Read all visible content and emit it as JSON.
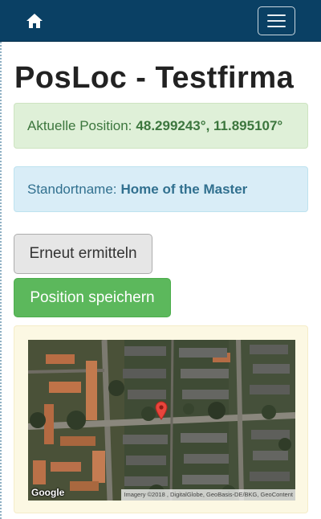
{
  "navbar": {
    "home_icon": "home-icon",
    "menu_icon": "hamburger-icon",
    "background": "#0a4064"
  },
  "page": {
    "title": "PosLoc - Testfirma"
  },
  "position_alert": {
    "label": "Aktuelle Position:",
    "value": "48.299243°, 11.895107°"
  },
  "location_alert": {
    "label": "Standortname:",
    "value": "Home of the Master"
  },
  "buttons": {
    "refresh_label": "Erneut ermitteln",
    "save_label": "Position speichern"
  },
  "map": {
    "logo": "Google",
    "attribution": "Imagery ©2018 , DigitalGlobe, GeoBasis-DE/BKG, GeoContent",
    "marker_icon": "map-pin-icon"
  },
  "colors": {
    "success": "#5cb85c",
    "info_text": "#31708f",
    "success_text": "#3c763d"
  }
}
